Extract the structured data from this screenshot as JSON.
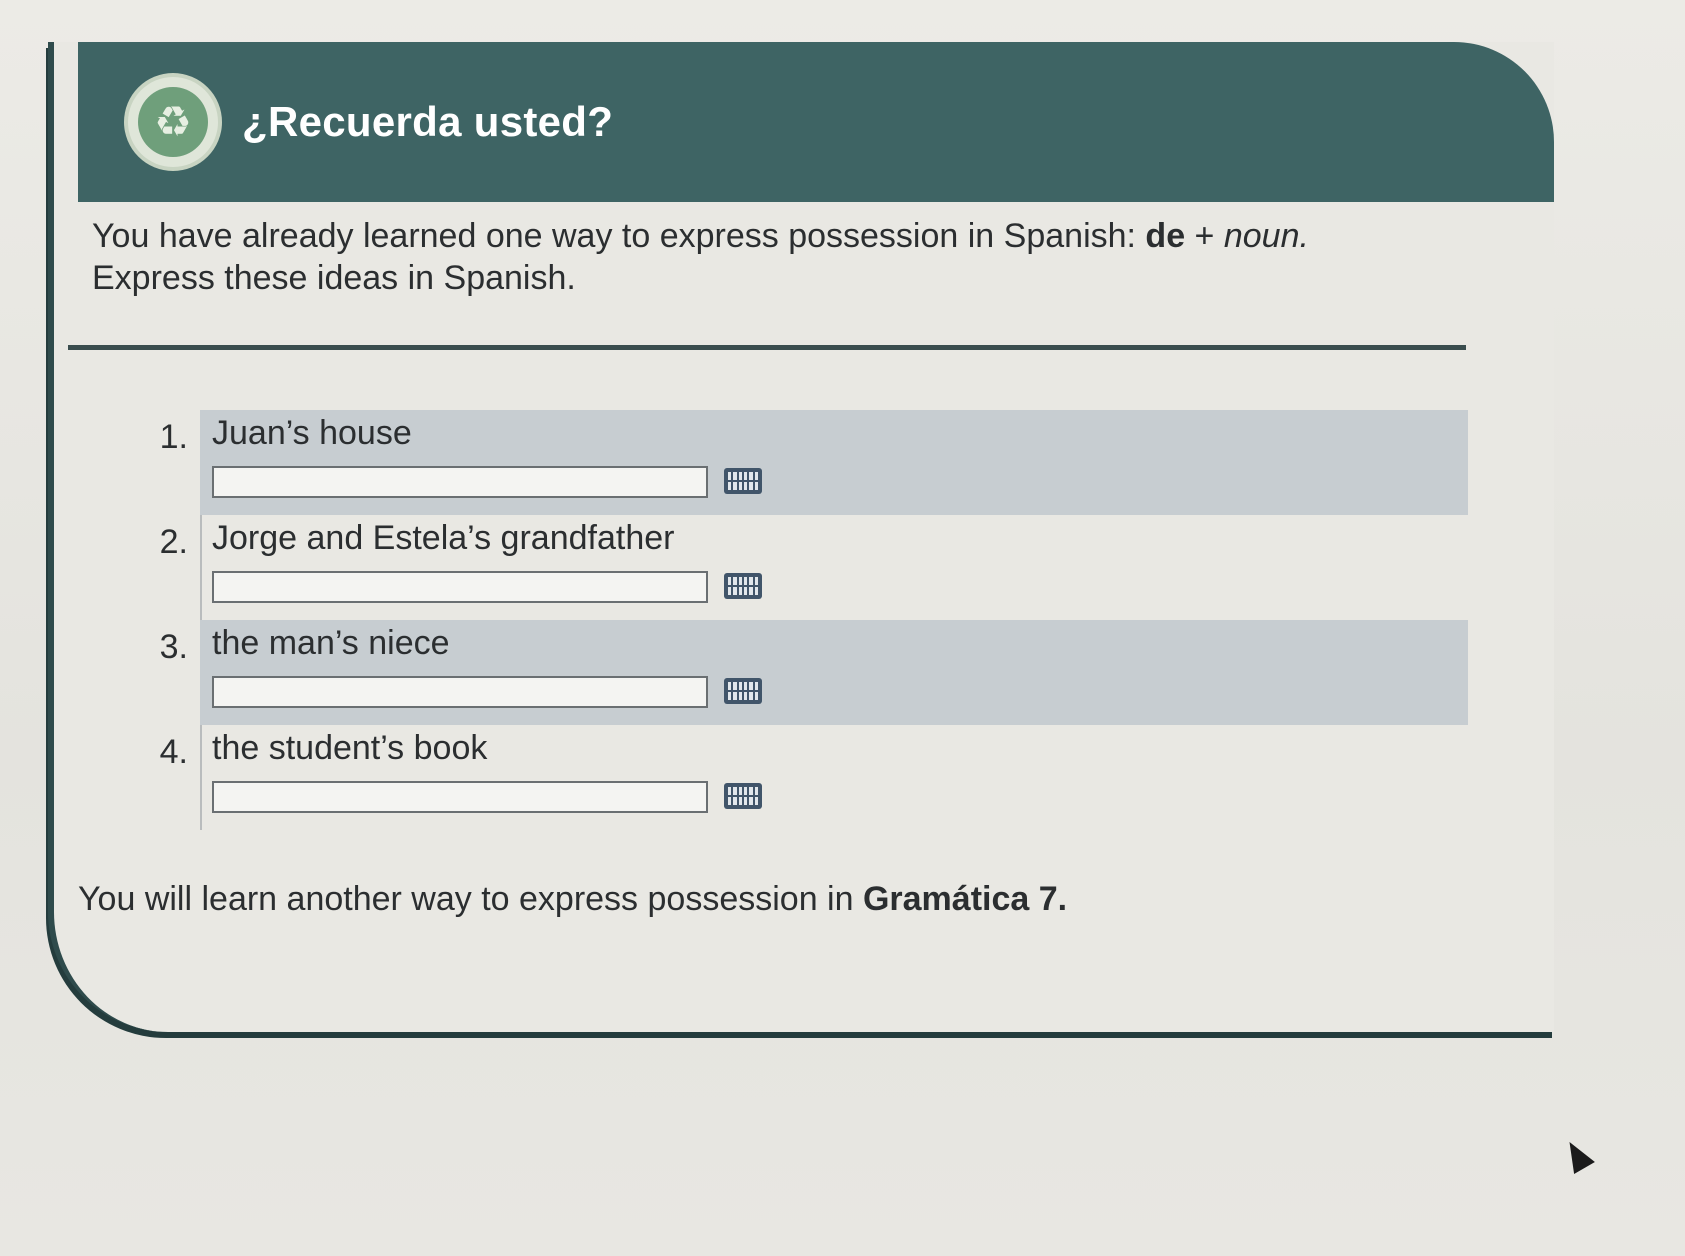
{
  "header": {
    "title": "¿Recuerda usted?",
    "badge_icon": "recycle-icon"
  },
  "intro": {
    "text_before": "You have already learned one way to express possession in Spanish: ",
    "bold": "de",
    "plus": " + ",
    "italic": "noun.",
    "line2": "Express these ideas in Spanish."
  },
  "questions": [
    {
      "number": "1.",
      "prompt": "Juan’s house",
      "value": "",
      "shaded": true
    },
    {
      "number": "2.",
      "prompt": "Jorge and Estela’s grandfather",
      "value": "",
      "shaded": false
    },
    {
      "number": "3.",
      "prompt": "the man’s niece",
      "value": "",
      "shaded": true
    },
    {
      "number": "4.",
      "prompt": "the student’s book",
      "value": "",
      "shaded": false
    }
  ],
  "outro": {
    "text": "You will learn another way to express possession in ",
    "bold": "Gramática 7."
  },
  "colors": {
    "header_bg": "#3e6464",
    "shaded_row": "#c7cdd1",
    "keyboard_icon": "#41556a"
  }
}
